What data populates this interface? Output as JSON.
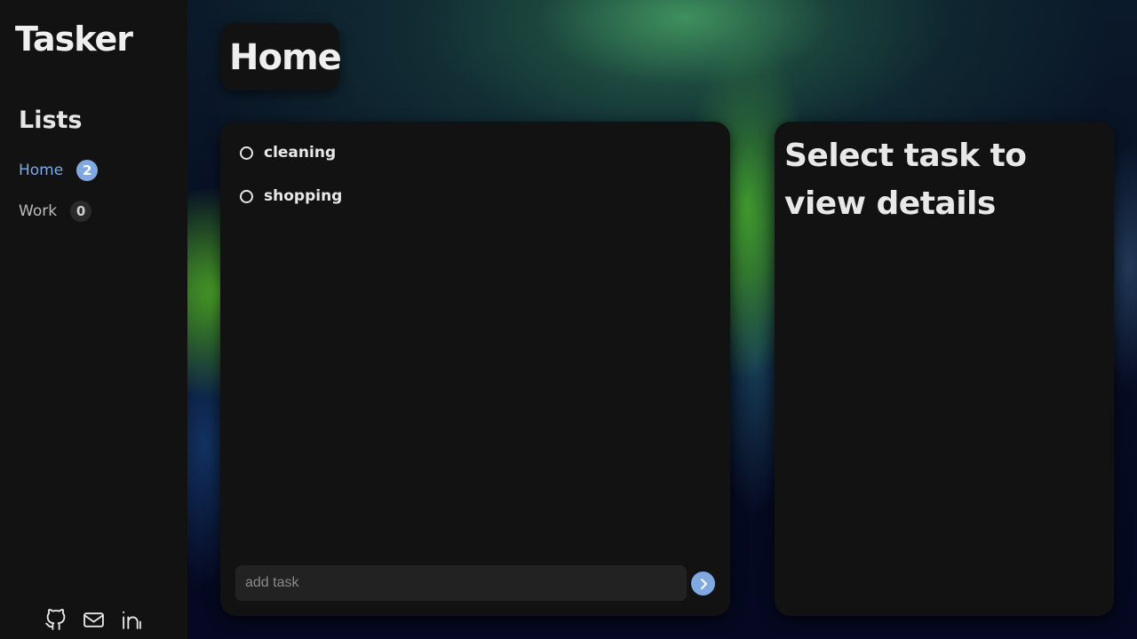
{
  "app": {
    "brand": "Tasker"
  },
  "sidebar": {
    "lists_heading": "Lists",
    "items": [
      {
        "label": "Home",
        "count": "2",
        "active": true
      },
      {
        "label": "Work",
        "count": "0",
        "active": false
      }
    ],
    "social_icons": [
      "github-icon",
      "mail-icon",
      "linkedin-icon"
    ]
  },
  "main": {
    "page_title": "Home",
    "tasks": [
      {
        "name": "cleaning"
      },
      {
        "name": "shopping"
      }
    ],
    "add_task": {
      "placeholder": "add task",
      "value": ""
    }
  },
  "details": {
    "empty_message": "Select task to view details"
  },
  "colors": {
    "accent": "#7fa9e0",
    "panel": "#121212",
    "input": "#222222"
  }
}
